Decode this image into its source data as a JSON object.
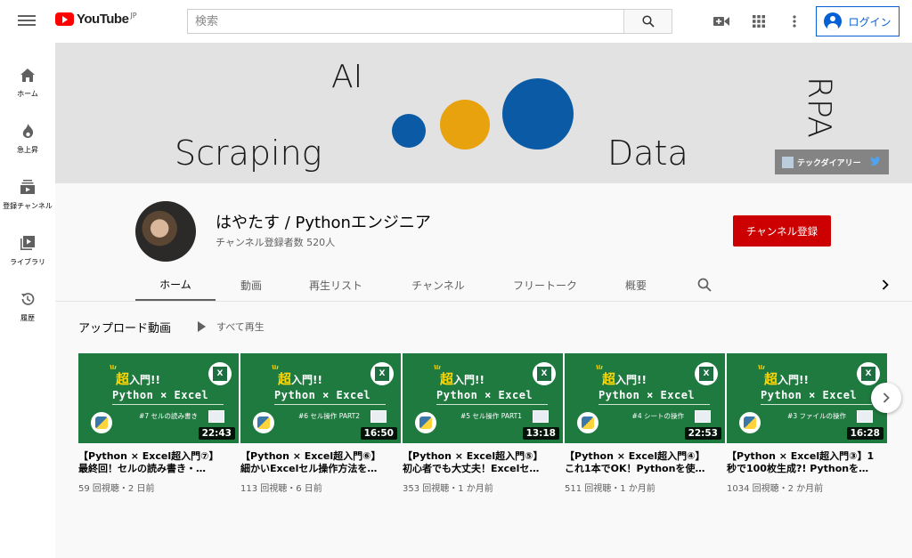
{
  "header": {
    "logo_text": "YouTube",
    "logo_region": "JP",
    "search_placeholder": "検索",
    "login_label": "ログイン"
  },
  "sidebar": {
    "items": [
      {
        "label": "ホーム",
        "icon": "home-icon"
      },
      {
        "label": "急上昇",
        "icon": "flame-icon"
      },
      {
        "label": "登録チャンネル",
        "icon": "subscriptions-icon"
      },
      {
        "label": "ライブラリ",
        "icon": "library-icon"
      },
      {
        "label": "履歴",
        "icon": "history-icon"
      }
    ]
  },
  "banner": {
    "words": [
      "AI",
      "Scraping",
      "Data",
      "RPA"
    ],
    "link_label": "テックダイアリー",
    "colors": {
      "blue": "#0b5aa5",
      "orange": "#e8a20d"
    }
  },
  "channel": {
    "name": "はやたす / Pythonエンジニア",
    "subscribers": "チャンネル登録者数 520人",
    "subscribe_label": "チャンネル登録",
    "tabs": [
      "ホーム",
      "動画",
      "再生リスト",
      "チャンネル",
      "フリートーク",
      "概要"
    ]
  },
  "shelf": {
    "title": "アップロード動画",
    "play_all": "すべて再生",
    "videos": [
      {
        "thumb_sub": "#7 セルの読み書き",
        "duration": "22:43",
        "title_line1": "【Python × Excel超入門⑦】",
        "title_line2": "最終回！セルの読み書き・…",
        "meta": "59 回視聴・2 日前"
      },
      {
        "thumb_sub": "#6 セル操作 PART2",
        "duration": "16:50",
        "title_line1": "【Python × Excel超入門⑥】",
        "title_line2": "細かいExcelセル操作方法を…",
        "meta": "113 回視聴・6 日前"
      },
      {
        "thumb_sub": "#5 セル操作 PART1",
        "duration": "13:18",
        "title_line1": "【Python × Excel超入門⑤】",
        "title_line2": "初心者でも大丈夫！Excelセ…",
        "meta": "353 回視聴・1 か月前"
      },
      {
        "thumb_sub": "#4 シートの操作",
        "duration": "22:53",
        "title_line1": "【Python × Excel超入門④】",
        "title_line2": "これ1本でOK！Pythonを使…",
        "meta": "511 回視聴・1 か月前"
      },
      {
        "thumb_sub": "#3 ファイルの操作",
        "duration": "16:28",
        "title_line1": "【Python × Excel超入門③】1",
        "title_line2": "秒で100枚生成?! Pythonを…",
        "meta": "1034 回視聴・2 か月前"
      }
    ],
    "thumb_heading_prefix": "超",
    "thumb_heading_rest": "入門!!",
    "thumb_heading2": "Python × Excel",
    "thumb_excel_letter": "X"
  }
}
